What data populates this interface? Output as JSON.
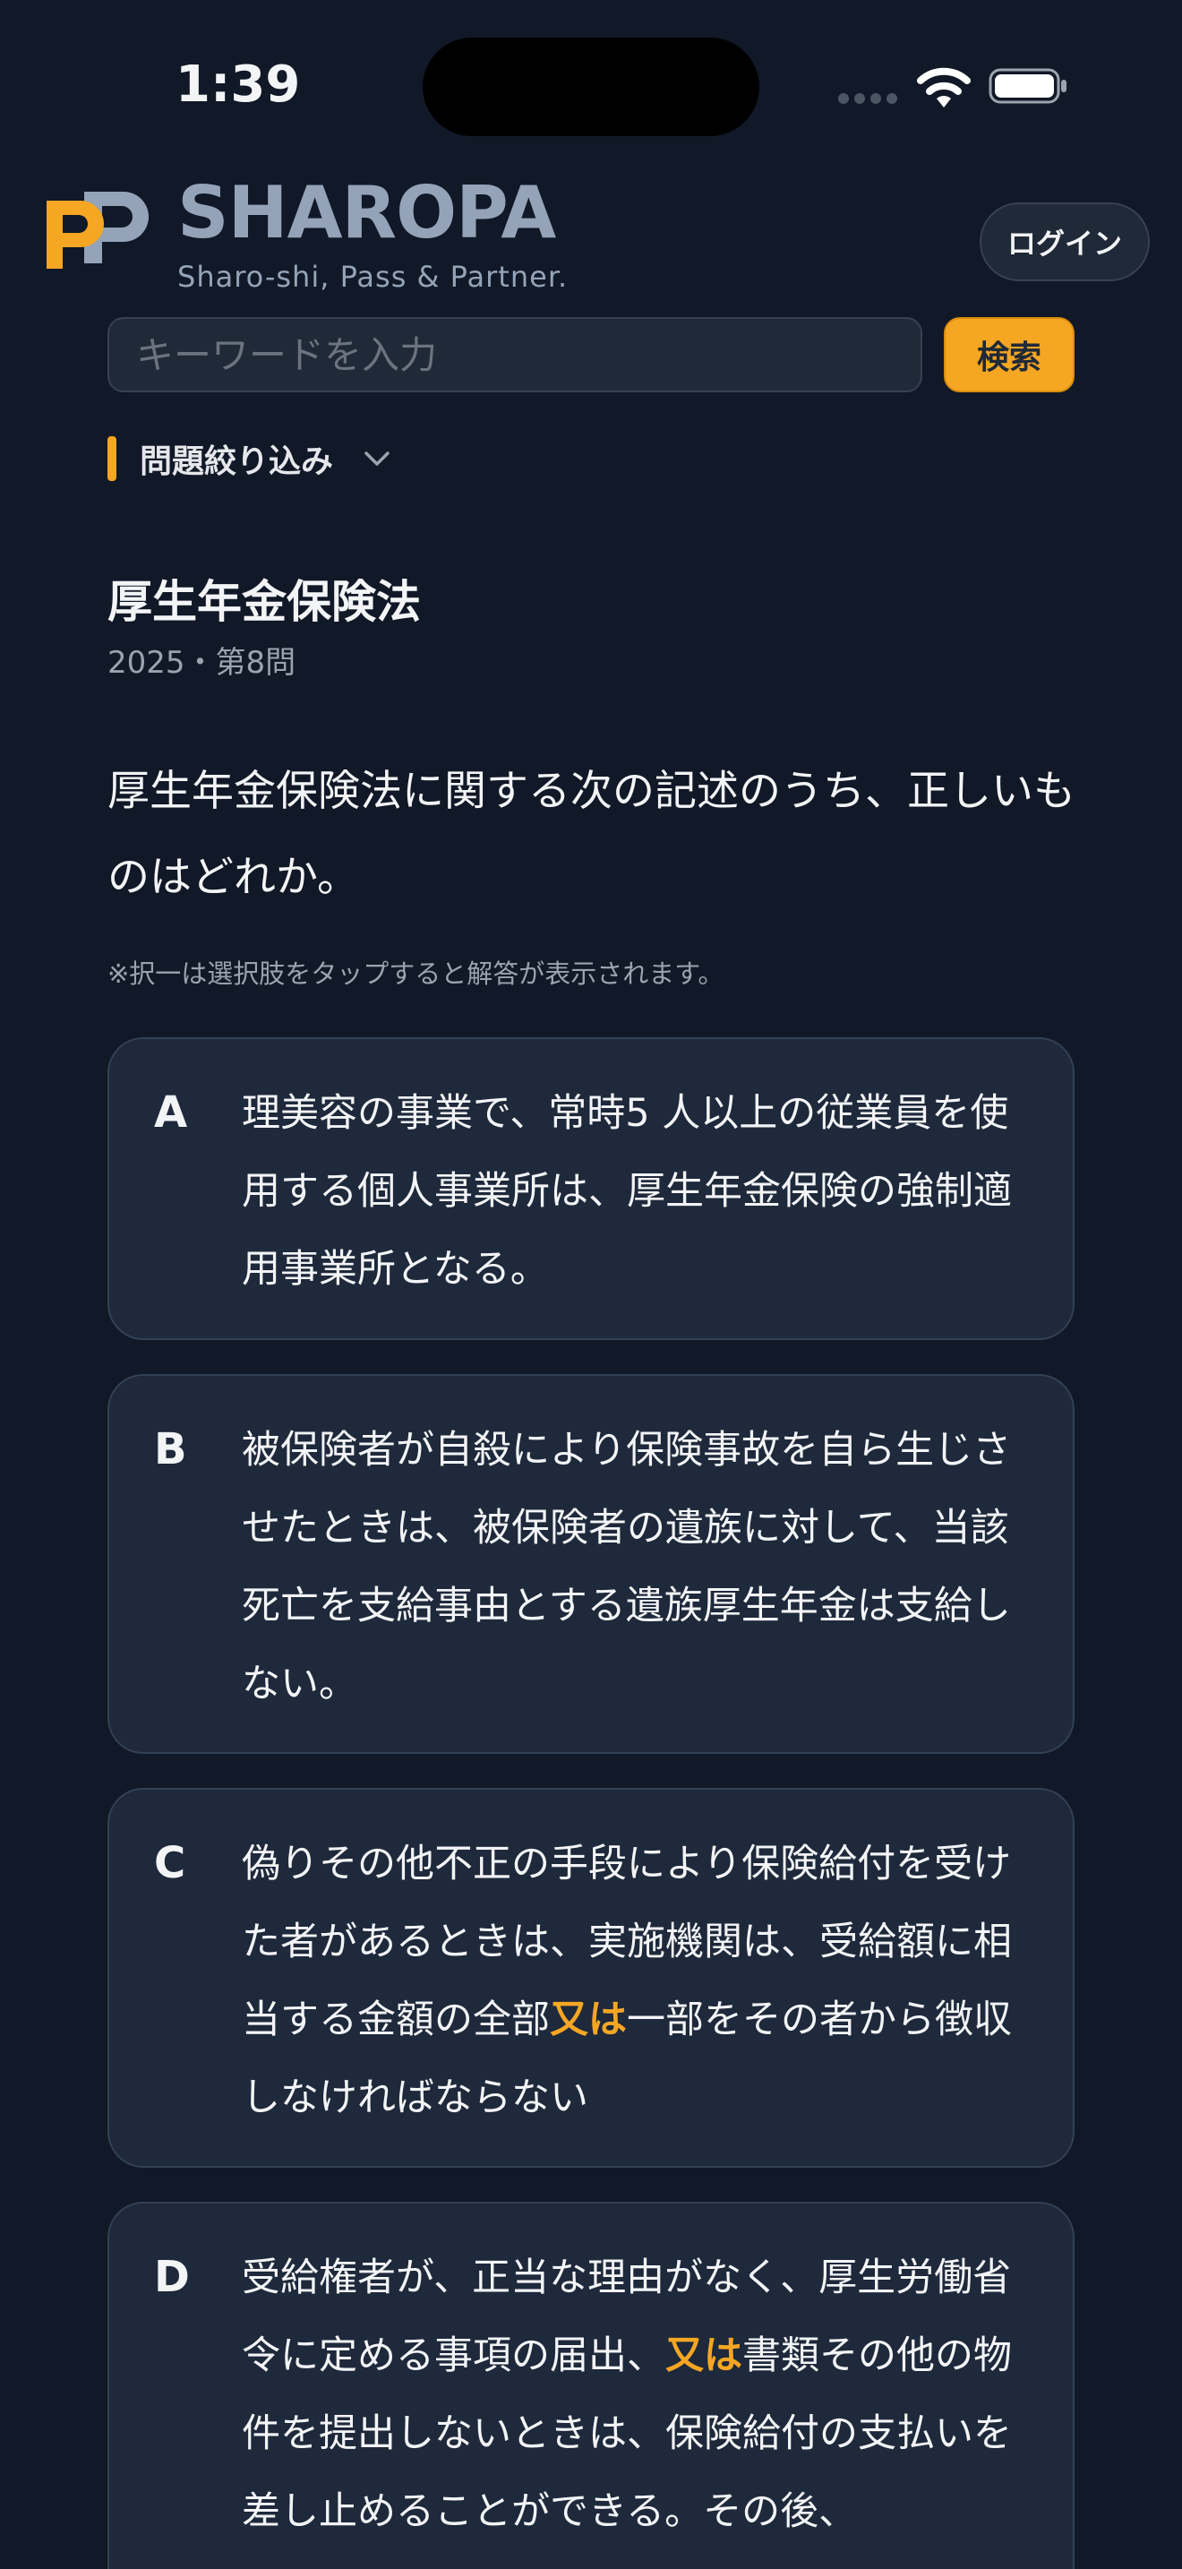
{
  "status_bar": {
    "time": "1:39"
  },
  "header": {
    "brand_name": "SHAROPA",
    "brand_tagline": "Sharo-shi, Pass & Partner.",
    "login_label": "ログイン"
  },
  "search": {
    "placeholder": "キーワードを入力",
    "button_label": "検索"
  },
  "filter": {
    "label": "問題絞り込み"
  },
  "question": {
    "law_title": "厚生年金保険法",
    "meta": "2025・第8問",
    "text": "厚生年金保険法に関する次の記述のうち、正しいものはどれか。",
    "note": "※択一は選択肢をタップすると解答が表示されます。"
  },
  "choices": [
    {
      "letter": "A",
      "text_before": "理美容の事業で、常時5 人以上の従業員を使用する個人事業所は、厚生年金保険の強制適用事業所となる。",
      "highlight": "",
      "text_after": ""
    },
    {
      "letter": "B",
      "text_before": "被保険者が自殺により保険事故を自ら生じさせたときは、被保険者の遺族に対して、当該死亡を支給事由とする遺族厚生年金は支給しない。",
      "highlight": "",
      "text_after": ""
    },
    {
      "letter": "C",
      "text_before": "偽りその他不正の手段により保険給付を受けた者があるときは、実施機関は、受給額に相当する金額の全部",
      "highlight": "又は",
      "text_after": "一部をその者から徴収しなければならない"
    },
    {
      "letter": "D",
      "text_before": "受給権者が、正当な理由がなく、厚生労働省令に定める事項の届出、",
      "highlight": "又は",
      "text_after": "書類その他の物件を提出しないときは、保険給付の支払いを差し止めることができる。その後、"
    }
  ],
  "colors": {
    "background": "#111827",
    "card": "#1e293b",
    "accent": "#f5a623",
    "brand_gray": "#94a3b8"
  }
}
